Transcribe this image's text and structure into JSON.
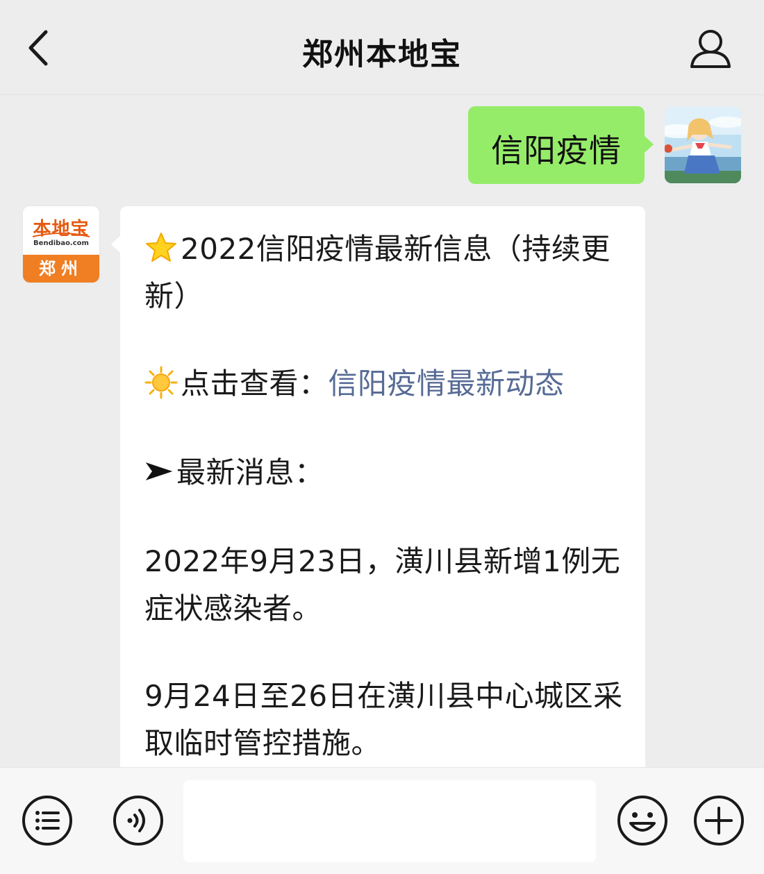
{
  "header": {
    "title": "郑州本地宝"
  },
  "chat": {
    "user_message": "信阳疫情",
    "bot": {
      "avatar_logo_text": "本地宝",
      "avatar_logo_sub": "Bendibao.com",
      "avatar_city": "郑州"
    },
    "bot_message": {
      "headline": "2022信阳疫情最新信息（持续更新）",
      "view_prefix": "点击查看：",
      "view_link": "信阳疫情最新动态",
      "latest_label": "最新消息：",
      "paragraph1": "2022年9月23日，潢川县新增1例无症状感染者。",
      "paragraph2": "9月24日至26日在潢川县中心城区采取临时管控措施。"
    }
  },
  "input": {
    "placeholder": ""
  },
  "colors": {
    "background": "#ededed",
    "user_bubble": "#95ec69",
    "bot_bubble": "#ffffff",
    "link": "#576b95",
    "brand_orange": "#f07e23"
  },
  "icons": {
    "back": "chevron-left-icon",
    "profile": "user-icon",
    "star": "star-emoji-icon",
    "sun": "sun-emoji-icon",
    "arrow": "arrow-right-icon",
    "menu": "menu-list-icon",
    "voice": "voice-icon",
    "emoji": "smiley-icon",
    "plus": "plus-icon"
  }
}
